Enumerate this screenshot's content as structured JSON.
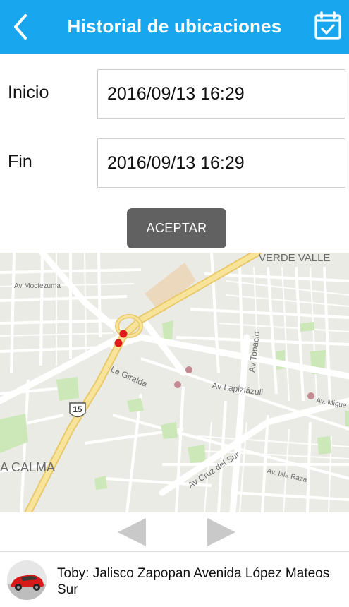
{
  "header": {
    "title": "Historial de ubicaciones",
    "back_icon": "chevron-left-icon",
    "calendar_icon": "calendar-check-icon",
    "background": "#18a7ee"
  },
  "form": {
    "start_label": "Inicio",
    "start_value": "2016/09/13 16:29",
    "end_label": "Fin",
    "end_value": "2016/09/13 16:29",
    "accept_label": "ACEPTAR"
  },
  "map": {
    "labels": {
      "verde_valle": "VERDE VALLE",
      "moctezuma": "Av Moctezuma",
      "topacio": "Av Topacio",
      "la_giralda": "La Giralda",
      "lapizlazuli": "Av Lapizlázuli",
      "miguel": "Av. Migue",
      "calma": "A CALMA",
      "cruz_del_sur": "Av Cruz del Sur",
      "isla_raza": "Av. Isla Raza",
      "route_shield": "15"
    },
    "marker_color_current": "#e01b1b",
    "marker_color_history": "#c48a91"
  },
  "pager": {
    "prev_icon": "triangle-left-icon",
    "next_icon": "triangle-right-icon"
  },
  "vehicle": {
    "description": "Toby: Jalisco Zapopan Avenida López Mateos Sur",
    "thumb_icon": "red-car-icon"
  }
}
